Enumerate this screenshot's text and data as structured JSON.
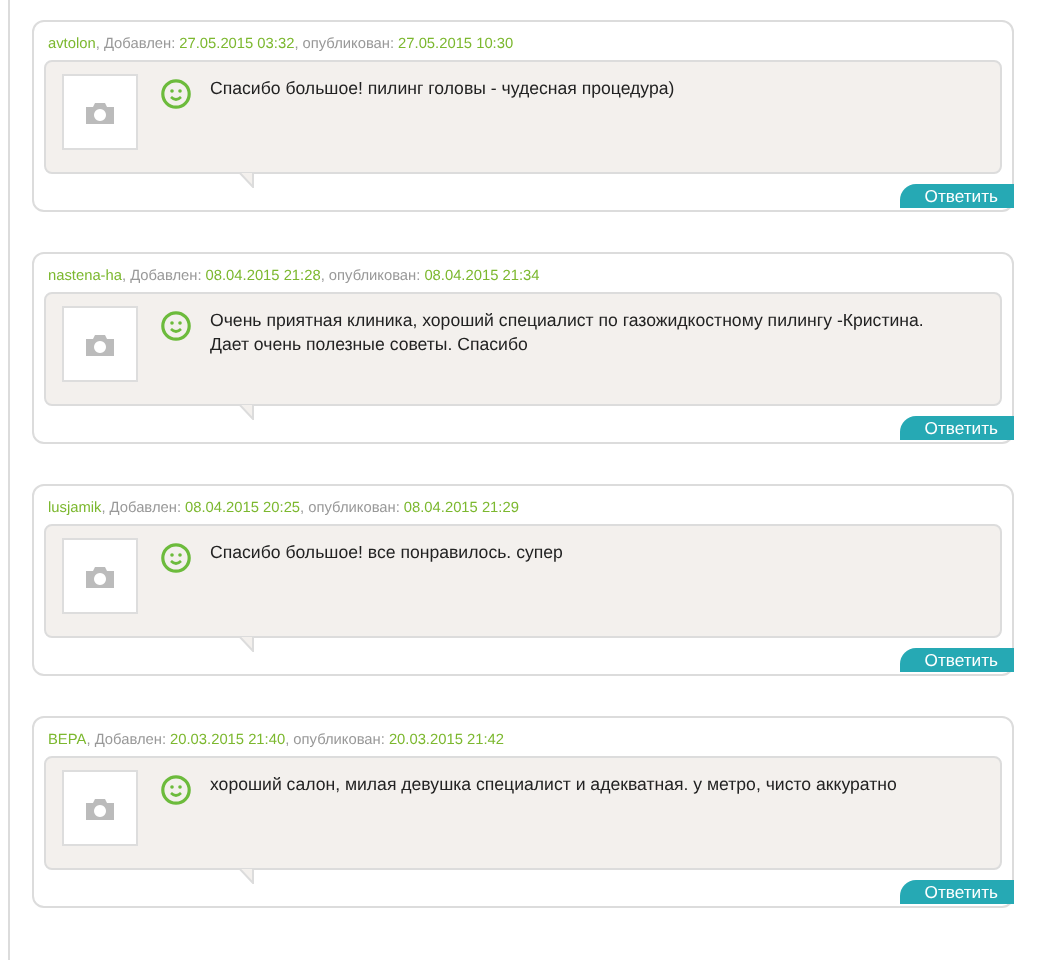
{
  "reviews": [
    {
      "author": "avtolon",
      "added_label": ", Добавлен:",
      "added": "27.05.2015 03:32",
      "published_label": ", опубликован:",
      "published": "27.05.2015 10:30",
      "happy": true,
      "text": "Спасибо большое! пилинг головы - чудесная процедура)",
      "reply": "Ответить"
    },
    {
      "author": "nastena-ha",
      "added_label": ", Добавлен:",
      "added": "08.04.2015 21:28",
      "published_label": ", опубликован:",
      "published": "08.04.2015 21:34",
      "happy": true,
      "text": "Очень приятная клиника, хороший специалист по газожидкостному пилингу -Кристина. Дает очень полезные советы. Спасибо",
      "reply": "Ответить"
    },
    {
      "author": "lusjamik",
      "added_label": ", Добавлен:",
      "added": "08.04.2015 20:25",
      "published_label": ", опубликован:",
      "published": "08.04.2015 21:29",
      "happy": true,
      "text": "Спасибо большое! все понравилось. супер",
      "reply": "Ответить"
    },
    {
      "author": "ВЕРА",
      "added_label": ", Добавлен:",
      "added": "20.03.2015 21:40",
      "published_label": ", опубликован:",
      "published": "20.03.2015 21:42",
      "happy": true,
      "text": "хороший салон, милая девушка специалист и адекватная. у метро, чисто аккуратно",
      "reply": "Ответить"
    }
  ]
}
